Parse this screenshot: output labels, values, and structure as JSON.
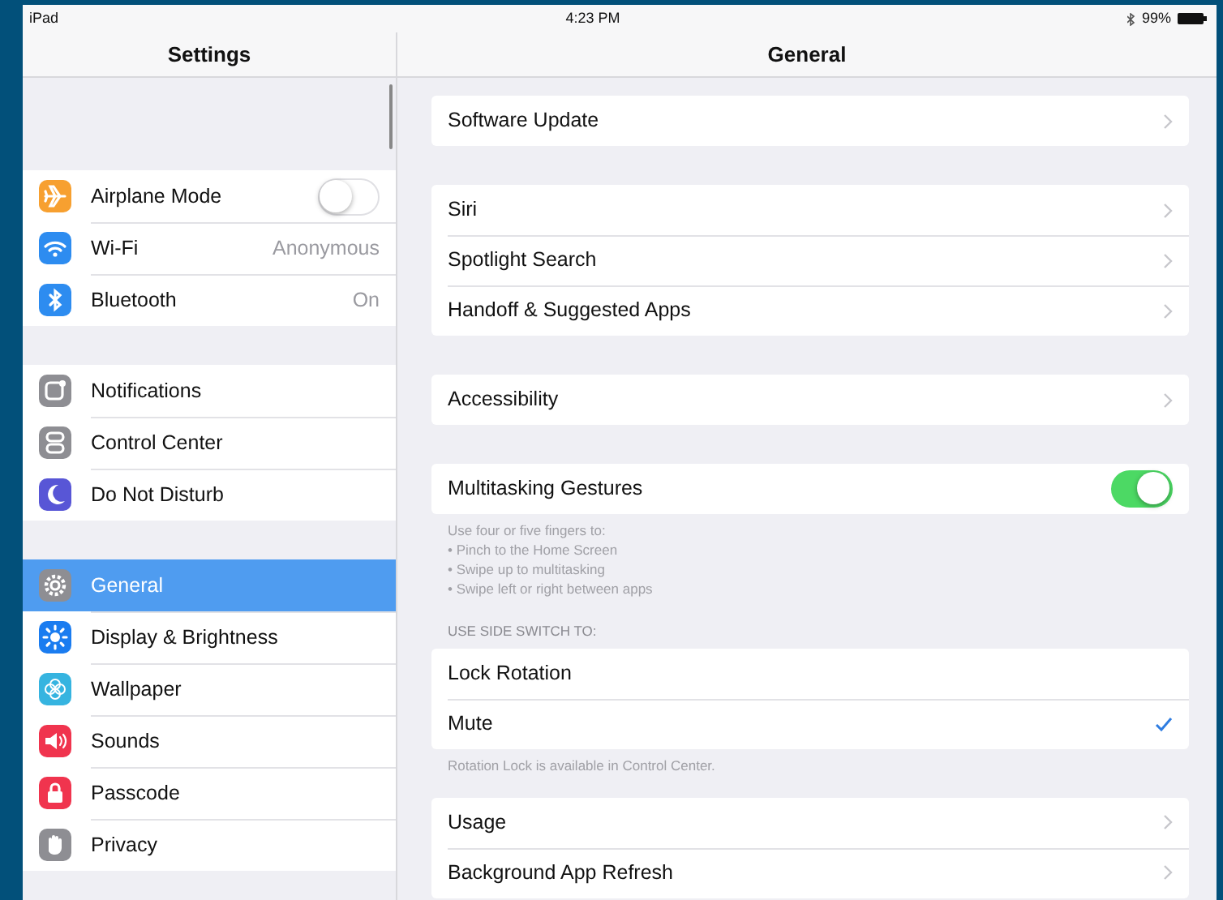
{
  "status_bar": {
    "device": "iPad",
    "time": "4:23 PM",
    "battery": "99%"
  },
  "sidebar": {
    "title": "Settings",
    "groups": [
      [
        {
          "label": "Airplane Mode",
          "color": "#f7a030",
          "kind": "switch",
          "on": false,
          "selected": false
        },
        {
          "label": "Wi-Fi",
          "color": "#2d8cf0",
          "kind": "value",
          "value": "Anonymous",
          "selected": false
        },
        {
          "label": "Bluetooth",
          "color": "#2d8cf0",
          "kind": "value",
          "value": "On",
          "selected": false
        }
      ],
      [
        {
          "label": "Notifications",
          "color": "#8e8e93",
          "kind": "plain",
          "selected": false
        },
        {
          "label": "Control Center",
          "color": "#8e8e93",
          "kind": "plain",
          "selected": false
        },
        {
          "label": "Do Not Disturb",
          "color": "#5856d6",
          "kind": "plain",
          "selected": false
        }
      ],
      [
        {
          "label": "General",
          "color": "#8e8e93",
          "kind": "plain",
          "selected": true
        },
        {
          "label": "Display & Brightness",
          "color": "#1a7cf0",
          "kind": "plain",
          "selected": false
        },
        {
          "label": "Wallpaper",
          "color": "#36b4e0",
          "kind": "plain",
          "selected": false
        },
        {
          "label": "Sounds",
          "color": "#f0344e",
          "kind": "plain",
          "selected": false
        },
        {
          "label": "Passcode",
          "color": "#f0344e",
          "kind": "plain",
          "selected": false
        },
        {
          "label": "Privacy",
          "color": "#8e8e93",
          "kind": "plain",
          "selected": false
        }
      ]
    ]
  },
  "detail": {
    "title": "General",
    "sections": [
      {
        "rows": [
          {
            "label": "Software Update",
            "kind": "link"
          }
        ]
      },
      {
        "rows": [
          {
            "label": "Siri",
            "kind": "link"
          },
          {
            "label": "Spotlight Search",
            "kind": "link"
          },
          {
            "label": "Handoff & Suggested Apps",
            "kind": "link"
          }
        ]
      },
      {
        "rows": [
          {
            "label": "Accessibility",
            "kind": "link"
          }
        ]
      },
      {
        "rows": [
          {
            "label": "Multitasking Gestures",
            "kind": "switch",
            "on": true
          }
        ],
        "footer_lines": [
          "Use four or five fingers to:",
          "• Pinch to the Home Screen",
          "• Swipe up to multitasking",
          "• Swipe left or right between apps"
        ]
      },
      {
        "header": "USE SIDE SWITCH TO:",
        "rows": [
          {
            "label": "Lock Rotation",
            "kind": "choice",
            "selected": false
          },
          {
            "label": "Mute",
            "kind": "choice",
            "selected": true
          }
        ],
        "footer_lines": [
          "Rotation Lock is available in Control Center."
        ]
      },
      {
        "rows": [
          {
            "label": "Usage",
            "kind": "link"
          },
          {
            "label": "Background App Refresh",
            "kind": "link"
          }
        ]
      }
    ]
  }
}
